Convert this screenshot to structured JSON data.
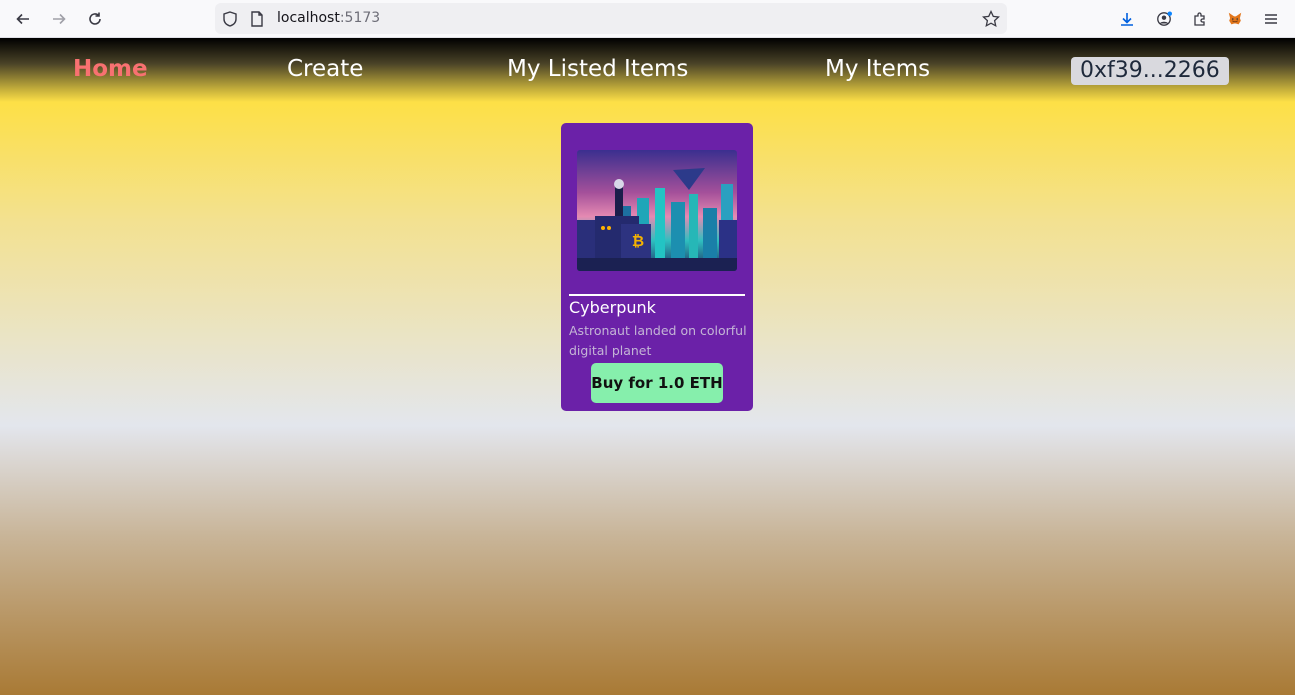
{
  "browser": {
    "url_host": "localhost",
    "url_port": ":5173"
  },
  "nav": {
    "home": "Home",
    "create": "Create",
    "listed": "My Listed Items",
    "my_items": "My Items",
    "wallet": "0xf39...2266"
  },
  "items": [
    {
      "name": "Cyberpunk",
      "description": "Astronaut landed on colorful digital planet",
      "buy_label": "Buy for 1.0 ETH"
    }
  ],
  "colors": {
    "active_nav": "#f87171",
    "card": "#6b21a8",
    "buy_button": "#86efac"
  }
}
